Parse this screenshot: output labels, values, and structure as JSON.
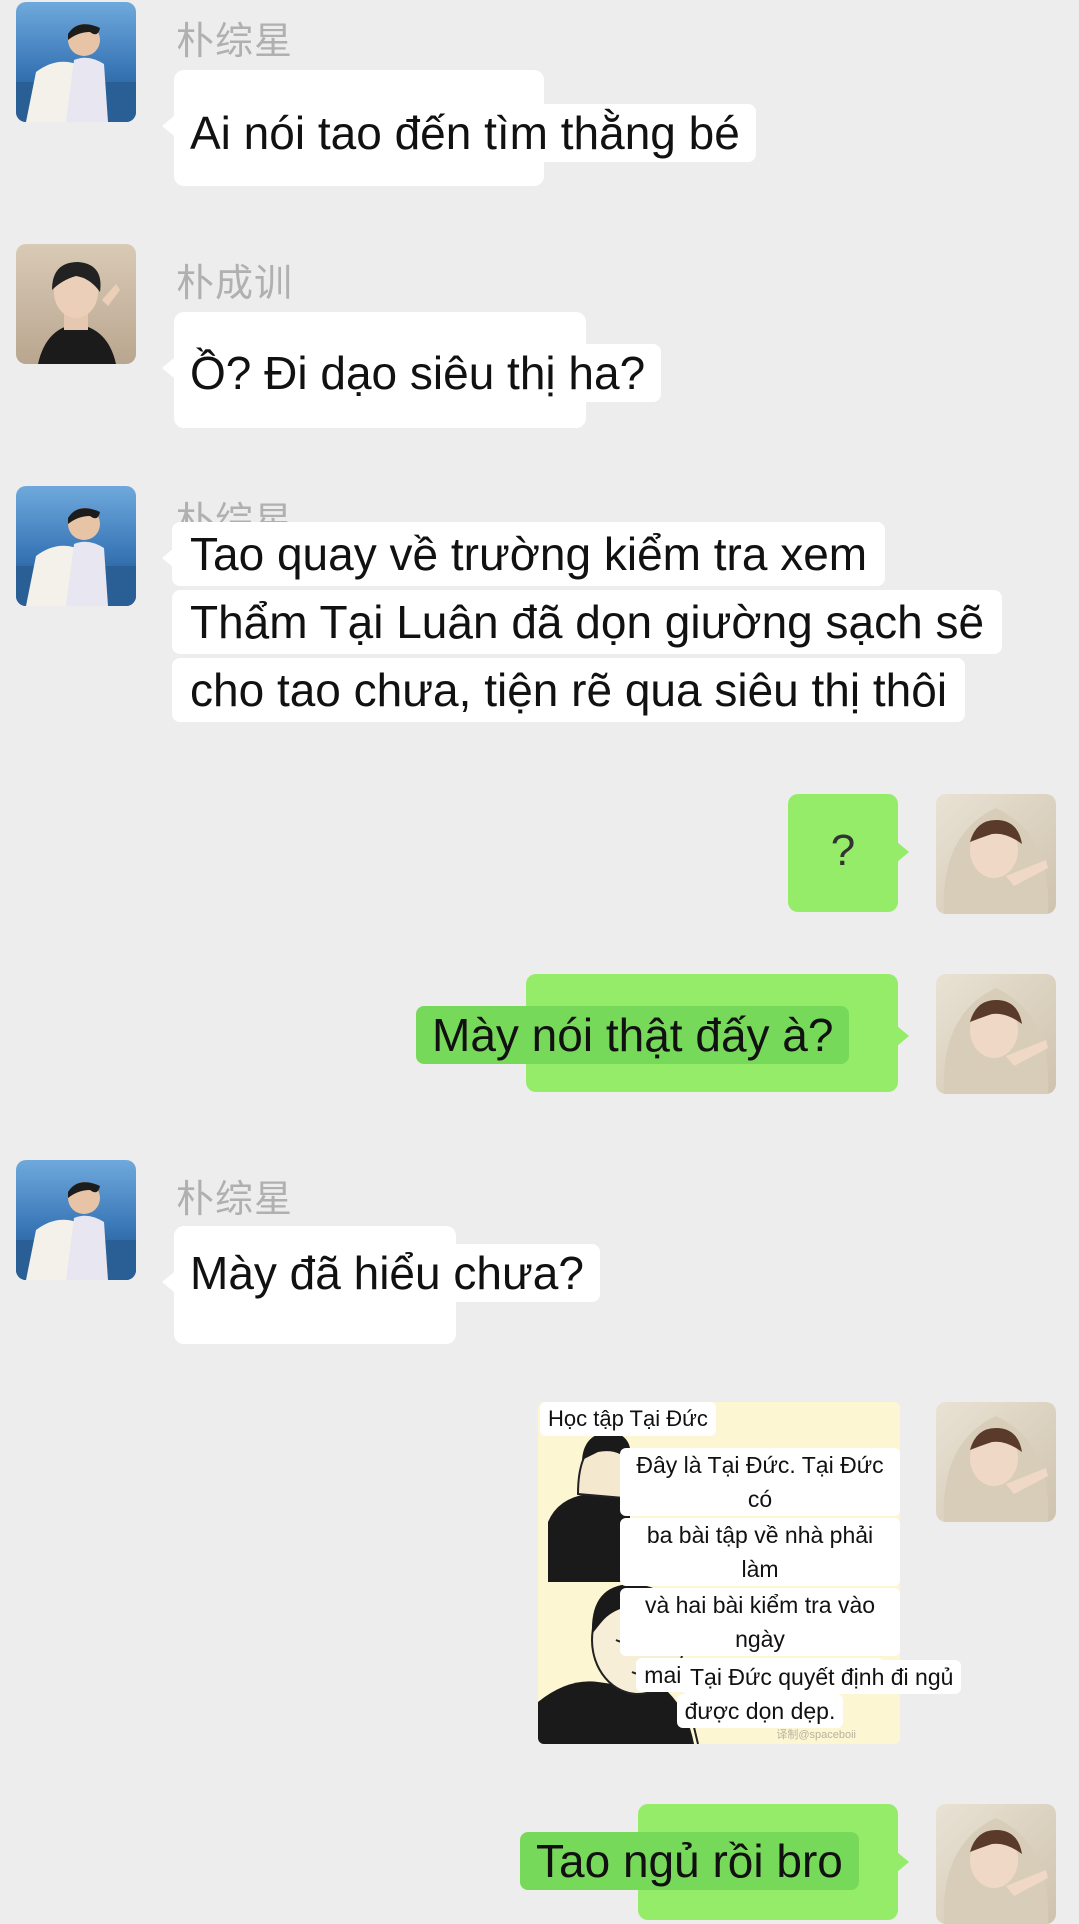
{
  "senders": {
    "zongxing": "朴综星",
    "chengxun": "朴成训"
  },
  "messages": {
    "m1": "Ai nói tao đến tìm thằng bé",
    "m2": "Ồ? Đi dạo siêu thị ha?",
    "m3_lines": [
      "Tao quay về trường kiểm tra xem",
      "Thẩm Tại Luân đã dọn giường sạch sẽ",
      "cho tao chưa, tiện rẽ qua siêu thị thôi"
    ],
    "m4": "?",
    "m5": "Mày nói thật đấy à?",
    "m6": "Mày đã hiểu chưa?",
    "m8": "Tao ngủ rồi bro"
  },
  "meme": {
    "title": "Học tập Tại Đức",
    "caption_lines": [
      "Đây là Tại Đức. Tại Đức có",
      "ba bài tập về nhà phải làm",
      "và hai bài kiểm tra vào ngày",
      "mai, và căn phòng cần",
      "được dọn dẹp."
    ],
    "caption2": "Tại Đức quyết định đi ngủ",
    "watermark": "译制@spaceboii"
  },
  "colors": {
    "background": "#ededed",
    "bubble_in": "#ffffff",
    "bubble_out": "#95ec69",
    "label_green": "#77d95a"
  }
}
